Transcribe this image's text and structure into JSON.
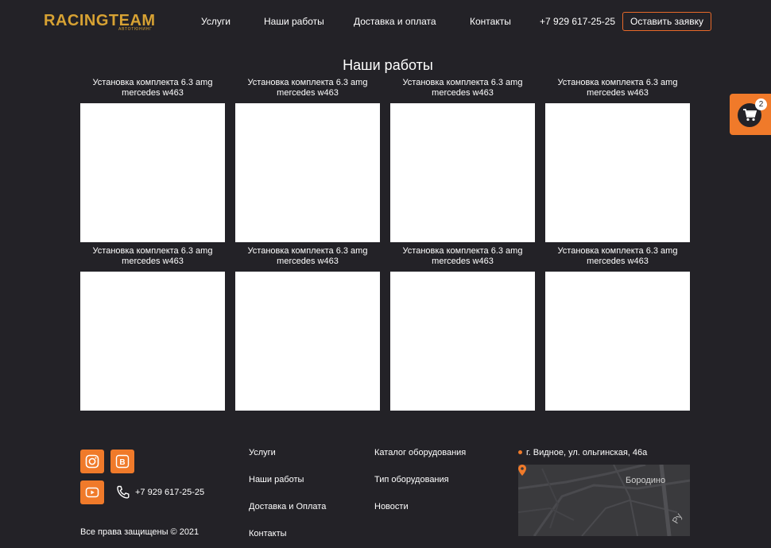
{
  "header": {
    "logo_text": "RACINGTEAM",
    "logo_sub": "АВТОТЮНИНГ",
    "nav": [
      "Услуги",
      "Наши работы",
      "Доставка и оплата",
      "Контакты"
    ],
    "phone": "+7 929 617-25-25",
    "cta_label": "Оставить заявку"
  },
  "cart": {
    "count": "2",
    "icon": "cart-icon"
  },
  "main": {
    "title": "Наши работы",
    "works": [
      {
        "title": "Установка комплекта 6.3 amg mercedes w463"
      },
      {
        "title": "Установка комплекта 6.3 amg mercedes w463"
      },
      {
        "title": "Установка комплекта 6.3 amg mercedes w463"
      },
      {
        "title": "Установка комплекта 6.3 amg mercedes w463"
      },
      {
        "title": "Установка комплекта 6.3 amg mercedes w463"
      },
      {
        "title": "Установка комплекта 6.3 amg mercedes w463"
      },
      {
        "title": "Установка комплекта 6.3 amg mercedes w463"
      },
      {
        "title": "Установка комплекта 6.3 amg mercedes w463"
      }
    ]
  },
  "footer": {
    "social": [
      "instagram-icon",
      "vk-icon",
      "youtube-icon"
    ],
    "phone": "+7 929 617-25-25",
    "copyright": "Все права защищены © 2021",
    "links_col1": [
      "Услуги",
      "Наши работы",
      "Доставка и Оплата",
      "Контакты"
    ],
    "links_col2": [
      "Каталог оборудования",
      "Тип оборудования",
      "Новости"
    ],
    "address": "г. Видное, ул. ольгинская, 46а",
    "map_label": "Бородино",
    "map_label2": "Ру"
  },
  "colors": {
    "accent": "#f07a2a",
    "logo": "#d7a233",
    "background": "#232227"
  }
}
